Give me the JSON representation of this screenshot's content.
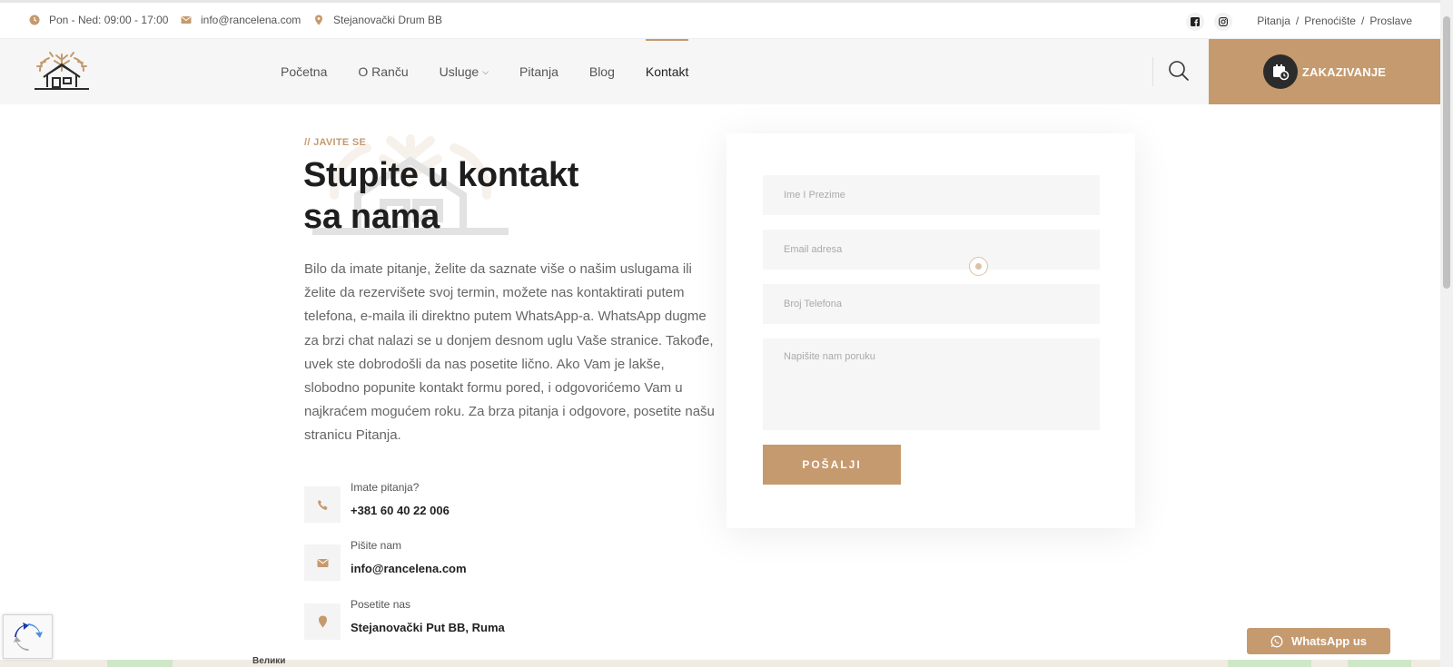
{
  "topbar": {
    "hours": "Pon - Ned: 09:00 - 17:00",
    "email": "info@rancelena.com",
    "address": "Stejanovački Drum BB",
    "links": [
      "Pitanja",
      "Prenoćište",
      "Proslave"
    ],
    "separator": "/"
  },
  "nav": {
    "items": [
      {
        "label": "Početna"
      },
      {
        "label": "O Ranču"
      },
      {
        "label": "Usluge"
      },
      {
        "label": "Pitanja"
      },
      {
        "label": "Blog"
      },
      {
        "label": "Kontakt"
      }
    ],
    "active": "Kontakt",
    "cta_label": "ZAKAZIVANJE"
  },
  "hero": {
    "eyebrow": "// JAVITE SE",
    "title_line1": "Stupite u kontakt",
    "title_line2": "sa nama",
    "description": "Bilo da imate pitanje, želite da saznate više o našim uslugama ili želite da rezervišete svoj termin, možete nas kontaktirati putem telefona, e-maila ili direktno putem WhatsApp-a. WhatsApp dugme za brzi chat nalazi se u donjem desnom uglu Vaše stranice. Takođe, uvek ste dobrodošli da nas posetite lično. Ako Vam je lakše, slobodno popunite kontakt formu pored, i odgovorićemo Vam u najkraćem mogućem roku. Za brza pitanja i odgovore, posetite našu stranicu Pitanja."
  },
  "contacts": [
    {
      "label": "Imate pitanja?",
      "value": "+381 60 40 22 006",
      "icon": "phone-icon"
    },
    {
      "label": "Pišite nam",
      "value": "info@rancelena.com",
      "icon": "mail-icon"
    },
    {
      "label": "Posetite nas",
      "value": "Stejanovački Put BB, Ruma",
      "icon": "location-icon"
    }
  ],
  "form": {
    "name_placeholder": "Ime I Prezime",
    "email_placeholder": "Email adresa",
    "phone_placeholder": "Broj Telefona",
    "message_placeholder": "Napišite nam poruku",
    "submit_label": "POŠALJI"
  },
  "map": {
    "label": "Велики"
  },
  "whatsapp": {
    "label": "WhatsApp us"
  },
  "colors": {
    "accent": "#c59a6e",
    "dark": "#2b2b2b"
  }
}
